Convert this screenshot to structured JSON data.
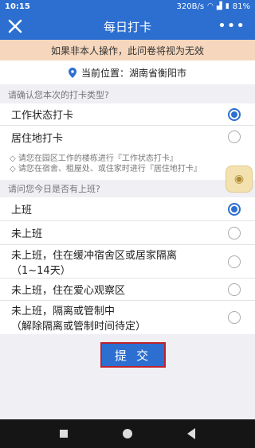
{
  "status_bar": {
    "time": "10:15",
    "speed": "320B/s",
    "battery": "81%"
  },
  "header": {
    "title": "每日打卡",
    "close_icon": "close-icon",
    "more_icon": "more-icon"
  },
  "warning": "如果非本人操作，此问卷将视为无效",
  "location": {
    "label": "当前位置：",
    "value": "湖南省衡阳市"
  },
  "section1": {
    "question": "请确认您本次的打卡类型?",
    "options": [
      {
        "label": "工作状态打卡",
        "selected": true
      },
      {
        "label": "居住地打卡",
        "selected": false
      }
    ],
    "hints": [
      "◇ 请您在园区工作的楼栋进行『工作状态打卡』",
      "◇ 请您在宿舍、租屋处、或住家时进行『居住地打卡』"
    ]
  },
  "section2": {
    "question": "请问您今日是否有上班?",
    "options": [
      {
        "label": "上班",
        "selected": true
      },
      {
        "label": "未上班",
        "selected": false
      },
      {
        "label": "未上班，住在缓冲宿舍区或居家隔离",
        "sub": "（1~14天）",
        "selected": false
      },
      {
        "label": "未上班，住在爱心观察区",
        "selected": false
      },
      {
        "label": "未上班，隔离或管制中",
        "sub": "（解除隔离或管制时间待定）",
        "selected": false
      }
    ]
  },
  "submit_label": "提 交",
  "colors": {
    "primary": "#2c6fd1",
    "warning_bg": "#f6d7bd",
    "highlight_border": "#c0212a"
  }
}
